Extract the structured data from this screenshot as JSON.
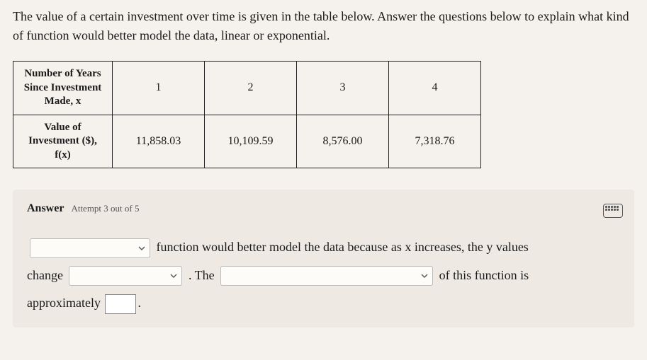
{
  "prompt": "The value of a certain investment over time is given in the table below. Answer the questions below to explain what kind of function would better model the data, linear or exponential.",
  "table": {
    "row1_header": "Number of Years Since Investment Made, x",
    "row1": [
      "1",
      "2",
      "3",
      "4"
    ],
    "row2_header": "Value of Investment ($), f(x)",
    "row2": [
      "11,858.03",
      "10,109.59",
      "8,576.00",
      "7,318.76"
    ]
  },
  "answer": {
    "title": "Answer",
    "attempt": "Attempt 3 out of 5",
    "line1_after": "function would better model the data because as x increases, the y values",
    "line2_before": "change",
    "line2_mid": ". The",
    "line2_after": "of this function is",
    "line3_before": "approximately",
    "line3_after": "."
  },
  "chart_data": {
    "type": "table",
    "x_label": "Number of Years Since Investment Made, x",
    "y_label": "Value of Investment ($), f(x)",
    "x": [
      1,
      2,
      3,
      4
    ],
    "y": [
      11858.03,
      10109.59,
      8576.0,
      7318.76
    ]
  }
}
